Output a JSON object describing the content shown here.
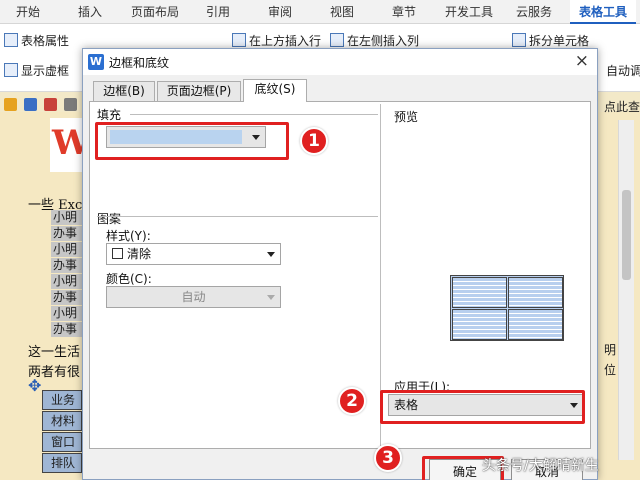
{
  "ribbon": {
    "tabs": [
      "开始",
      "插入",
      "页面布局",
      "引用",
      "审阅",
      "视图",
      "章节",
      "开发工具",
      "云服务",
      "表格工具"
    ],
    "active_tab": "表格工具",
    "buttons": {
      "table_props": "表格属性",
      "show_gridlines": "显示虚框",
      "insert_above": "在上方插入行",
      "insert_left": "在左侧插入列",
      "split_cells": "拆分单元格",
      "autofit": "自动调"
    }
  },
  "document": {
    "logo_letter": "W",
    "lines": [
      "一些 Exc",
      "这一生活",
      "两者有很"
    ],
    "highlight_rows": [
      "小明",
      "办事",
      "小明",
      "办事",
      "小明",
      "办事",
      "小明",
      "办事"
    ],
    "table_cells": [
      "业务",
      "材料",
      "窗口",
      "排队"
    ],
    "right_labels": [
      "点此查",
      "明",
      "位"
    ]
  },
  "dialog": {
    "title": "边框和底纹",
    "close_glyph": "×",
    "tabs": [
      "边框(B)",
      "页面边框(P)",
      "底纹(S)"
    ],
    "active_tab": "底纹(S)",
    "fill_label": "填充",
    "pattern_label": "图案",
    "style_label": "样式(Y):",
    "style_value": "清除",
    "color_label": "颜色(C):",
    "color_value": "自动",
    "preview_label": "预览",
    "apply_label": "应用于(L):",
    "apply_value": "表格",
    "ok_label": "确定",
    "cancel_label": "取消",
    "fill_color": "#b9d3ef"
  },
  "annotations": {
    "badges": [
      "1",
      "2",
      "3"
    ],
    "color": "#e02020"
  },
  "watermark": "头条号/大解晴新生"
}
